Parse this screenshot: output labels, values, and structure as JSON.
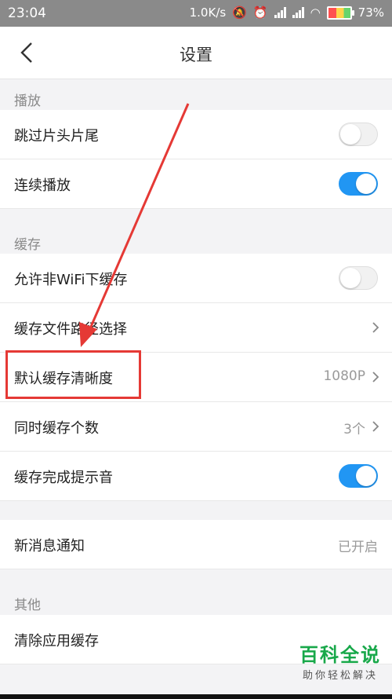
{
  "status_bar": {
    "time": "23:04",
    "speed": "1.0K/s",
    "battery": "73%"
  },
  "header": {
    "title": "设置"
  },
  "sections": {
    "playback": "播放",
    "cache": "缓存",
    "other": "其他"
  },
  "rows": {
    "skip_intro": {
      "label": "跳过片头片尾",
      "toggle_on": false
    },
    "continuous": {
      "label": "连续播放",
      "toggle_on": true
    },
    "allow_non_wifi": {
      "label": "允许非WiFi下缓存",
      "toggle_on": false
    },
    "cache_path": {
      "label": "缓存文件路径选择"
    },
    "default_clarity": {
      "label": "默认缓存清晰度",
      "value": "1080P"
    },
    "concurrent": {
      "label": "同时缓存个数",
      "value": "3个"
    },
    "finish_sound": {
      "label": "缓存完成提示音",
      "toggle_on": true
    },
    "notify": {
      "label": "新消息通知",
      "value": "已开启"
    },
    "clear_cache": {
      "label": "清除应用缓存"
    }
  },
  "watermark": {
    "title": "百科全说",
    "subtitle": "助你轻松解决"
  },
  "colors": {
    "accent": "#2196f3",
    "highlight": "#e53935",
    "watermark": "#18a84a"
  }
}
